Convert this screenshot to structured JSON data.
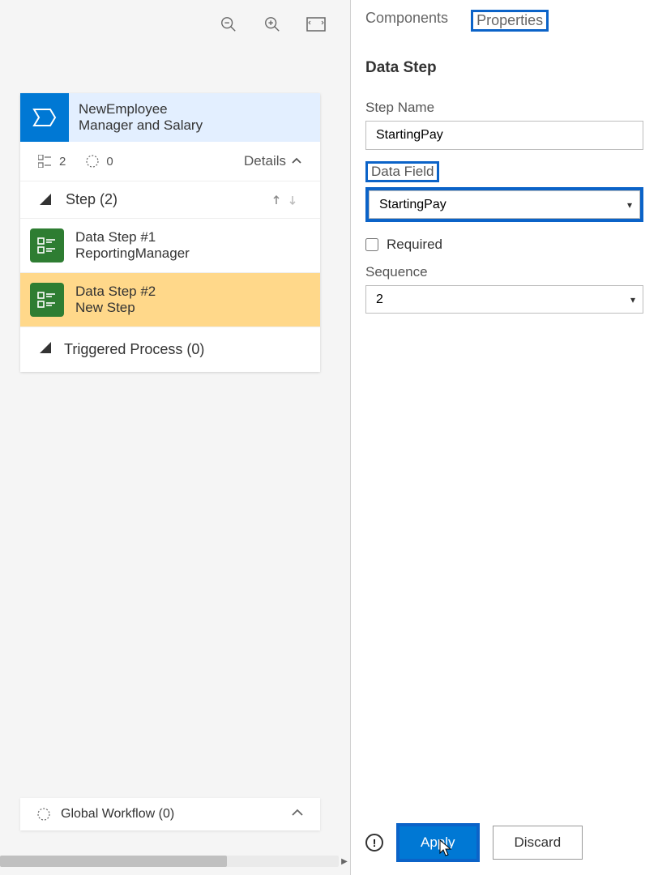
{
  "header": {
    "title1": "NewEmployee",
    "title2": "Manager and Salary"
  },
  "stats": {
    "steps_count": "2",
    "pending_count": "0",
    "details_label": "Details"
  },
  "step_section": {
    "label": "Step (2)"
  },
  "steps": [
    {
      "title": "Data Step #1",
      "subtitle": "ReportingManager"
    },
    {
      "title": "Data Step #2",
      "subtitle": "New Step"
    }
  ],
  "triggered": {
    "label": "Triggered Process (0)"
  },
  "global": {
    "label": "Global Workflow (0)"
  },
  "tabs": {
    "components": "Components",
    "properties": "Properties"
  },
  "panel": {
    "title": "Data Step",
    "step_name_label": "Step Name",
    "step_name_value": "StartingPay",
    "data_field_label": "Data Field",
    "data_field_value": "StartingPay",
    "required_label": "Required",
    "sequence_label": "Sequence",
    "sequence_value": "2"
  },
  "footer": {
    "apply": "Apply",
    "discard": "Discard"
  }
}
